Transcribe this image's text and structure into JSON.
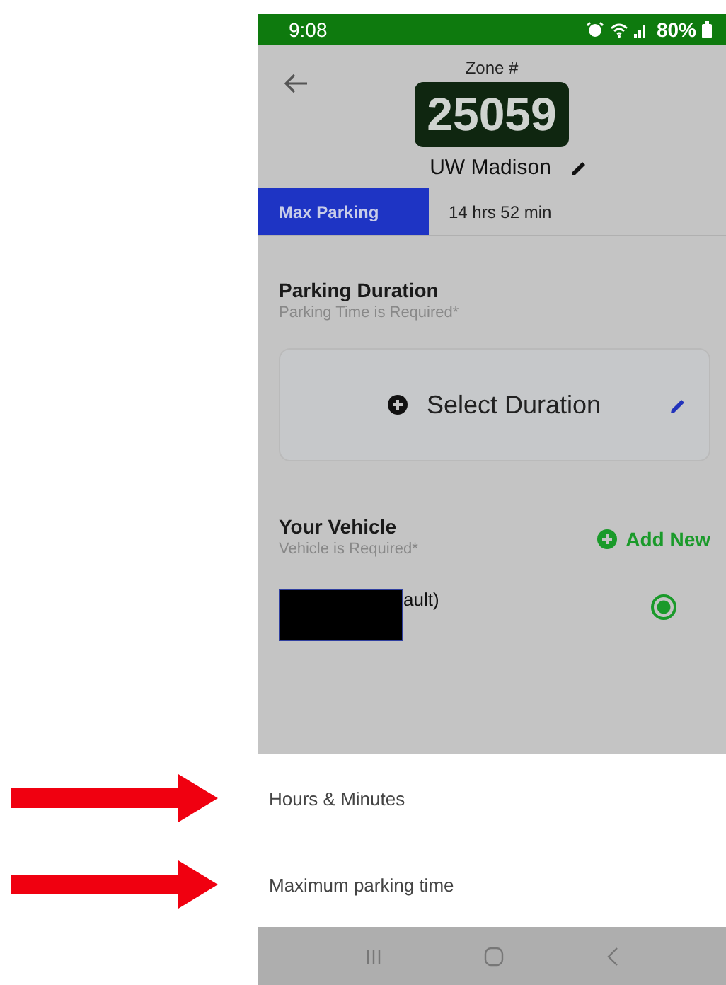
{
  "status_bar": {
    "time": "9:08",
    "battery": "80%"
  },
  "header": {
    "zone_label": "Zone #",
    "zone_number": "25059",
    "zone_name": "UW Madison"
  },
  "tabs": [
    {
      "label": "Max Parking",
      "selected": true
    },
    {
      "label": "14 hrs 52 min",
      "selected": false
    }
  ],
  "parking_duration": {
    "title": "Parking Duration",
    "subtitle": "Parking Time is Required*",
    "button": "Select Duration"
  },
  "vehicle": {
    "title": "Your Vehicle",
    "subtitle": "Vehicle is Required*",
    "add_button": "Add New",
    "items": [
      {
        "label": "ault)",
        "redacted": true,
        "selected": true
      }
    ]
  },
  "sheet_options": [
    {
      "label": "Hours & Minutes",
      "annotated": true
    },
    {
      "label": "Maximum parking time",
      "annotated": true
    }
  ]
}
